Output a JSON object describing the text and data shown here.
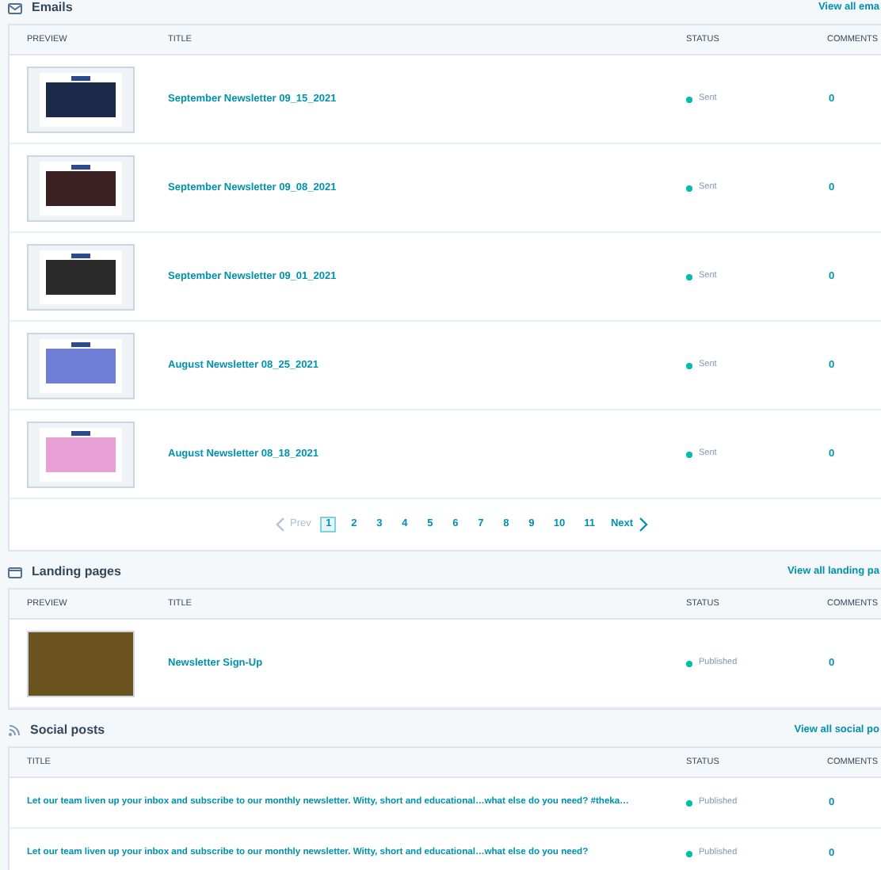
{
  "emails": {
    "title": "Emails",
    "view_all": "View all ema",
    "columns": [
      "PREVIEW",
      "TITLE",
      "STATUS",
      "COMMENTS"
    ],
    "rows": [
      {
        "title": "September Newsletter 09_15_2021",
        "status": "Sent",
        "comments": "0"
      },
      {
        "title": "September Newsletter 09_08_2021",
        "status": "Sent",
        "comments": "0"
      },
      {
        "title": "September Newsletter 09_01_2021",
        "status": "Sent",
        "comments": "0"
      },
      {
        "title": "August Newsletter 08_25_2021",
        "status": "Sent",
        "comments": "0"
      },
      {
        "title": "August Newsletter 08_18_2021",
        "status": "Sent",
        "comments": "0"
      }
    ],
    "pagination": {
      "prev": {
        "label": "Prev",
        "disabled": true
      },
      "pages": [
        {
          "label": "1",
          "selected": true
        },
        {
          "label": "2",
          "selected": false
        },
        {
          "label": "3",
          "selected": false
        },
        {
          "label": "4",
          "selected": false
        },
        {
          "label": "5",
          "selected": false
        },
        {
          "label": "6",
          "selected": false
        },
        {
          "label": "7",
          "selected": false
        },
        {
          "label": "8",
          "selected": false
        },
        {
          "label": "9",
          "selected": false
        },
        {
          "label": "10",
          "selected": false
        },
        {
          "label": "11",
          "selected": false
        }
      ],
      "next": {
        "label": "Next",
        "disabled": false
      }
    }
  },
  "landing_pages": {
    "title": "Landing pages",
    "view_all": "View all landing pa",
    "columns": [
      "PREVIEW",
      "TITLE",
      "STATUS",
      "COMMENTS"
    ],
    "rows": [
      {
        "title": "Newsletter Sign-Up",
        "status": "Published",
        "comments": "0"
      }
    ]
  },
  "social_posts": {
    "title": "Social posts",
    "view_all": "View all social po",
    "columns": [
      "TITLE",
      "STATUS",
      "COMMENTS"
    ],
    "rows": [
      {
        "title": "Let our team liven up your inbox and subscribe to our monthly newsletter. Witty, short and educational…what else do you need? #theka…",
        "status": "Published",
        "comments": "0"
      },
      {
        "title": "Let our team liven up your inbox and subscribe to our monthly newsletter. Witty, short and educational…what else do you need?",
        "status": "Published",
        "comments": "0"
      }
    ]
  }
}
